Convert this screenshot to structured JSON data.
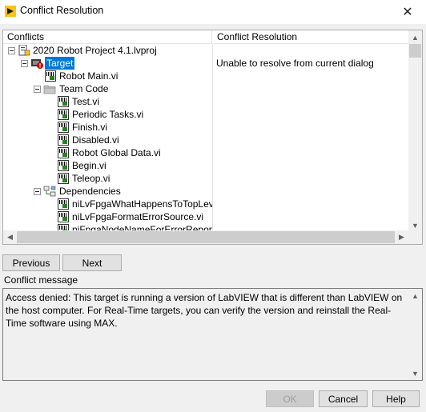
{
  "window": {
    "title": "Conflict Resolution",
    "close_glyph": "✕"
  },
  "tree": {
    "columns": {
      "conflicts": "Conflicts",
      "resolution": "Conflict Resolution"
    },
    "items": [
      {
        "label": "2020 Robot Project 4.1.lvproj",
        "icon": "project-icon"
      },
      {
        "label": "Target",
        "icon": "target-error-icon",
        "selected": true
      },
      {
        "label": "Robot Main.vi",
        "icon": "vi-icon"
      },
      {
        "label": "Team Code",
        "icon": "folder-icon"
      },
      {
        "label": "Test.vi",
        "icon": "vi-icon"
      },
      {
        "label": "Periodic Tasks.vi",
        "icon": "vi-icon"
      },
      {
        "label": "Finish.vi",
        "icon": "vi-icon"
      },
      {
        "label": "Disabled.vi",
        "icon": "vi-icon"
      },
      {
        "label": "Robot Global Data.vi",
        "icon": "vi-icon"
      },
      {
        "label": "Begin.vi",
        "icon": "vi-icon"
      },
      {
        "label": "Teleop.vi",
        "icon": "vi-icon"
      },
      {
        "label": "Dependencies",
        "icon": "dependencies-icon"
      },
      {
        "label": "niLvFpgaWhatHappensToTopLev",
        "icon": "vi-icon"
      },
      {
        "label": "niLvFpgaFormatErrorSource.vi",
        "icon": "vi-icon"
      },
      {
        "label": "niFpgaNodeNameForErrorReport",
        "icon": "vi-icon"
      }
    ],
    "resolution_text": "Unable to resolve from current dialog"
  },
  "nav": {
    "previous": "Previous",
    "next": "Next"
  },
  "message": {
    "label": "Conflict message",
    "text": "Access denied: This target is running a version of LabVIEW that is different than LabVIEW on the host computer. For Real-Time targets, you can verify the version and reinstall the Real-Time software using MAX."
  },
  "footer": {
    "ok": "OK",
    "cancel": "Cancel",
    "help": "Help"
  },
  "colors": {
    "selection": "#0078d7",
    "labview_yellow": "#f5c518"
  }
}
